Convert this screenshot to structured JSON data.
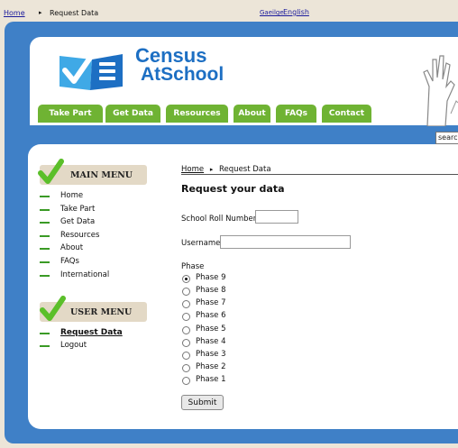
{
  "top_breadcrumb": {
    "home": "Home",
    "separator": "▸",
    "current": "Request Data"
  },
  "languages": {
    "irish": "Gaeilge",
    "english": "English"
  },
  "logo": {
    "line1": "Census",
    "line2": "AtSchool"
  },
  "nav": [
    "Take Part",
    "Get Data",
    "Resources",
    "About",
    "FAQs",
    "Contact"
  ],
  "search": {
    "value": "searc"
  },
  "main_menu": {
    "title": "MAIN MENU",
    "items": [
      "Home",
      "Take Part",
      "Get Data",
      "Resources",
      "About",
      "FAQs",
      "International"
    ]
  },
  "user_menu": {
    "title": "USER MENU",
    "items": [
      "Request Data",
      "Logout"
    ]
  },
  "breadcrumb": {
    "home": "Home",
    "separator": "▸",
    "current": "Request Data"
  },
  "form": {
    "title": "Request your data",
    "school_roll_label": "School Roll Number",
    "school_roll_value": "",
    "username_label": "Username",
    "username_value": "",
    "phase_label": "Phase",
    "phases": [
      "Phase 9",
      "Phase 8",
      "Phase 7",
      "Phase 6",
      "Phase 5",
      "Phase 4",
      "Phase 3",
      "Phase 2",
      "Phase 1"
    ],
    "selected_phase": "Phase 9",
    "submit_label": "Submit"
  },
  "colors": {
    "frame": "#3f80c7",
    "nav_green": "#6fb333",
    "logo_blue": "#1d6fc3",
    "menu_head": "#e3d9c6"
  }
}
